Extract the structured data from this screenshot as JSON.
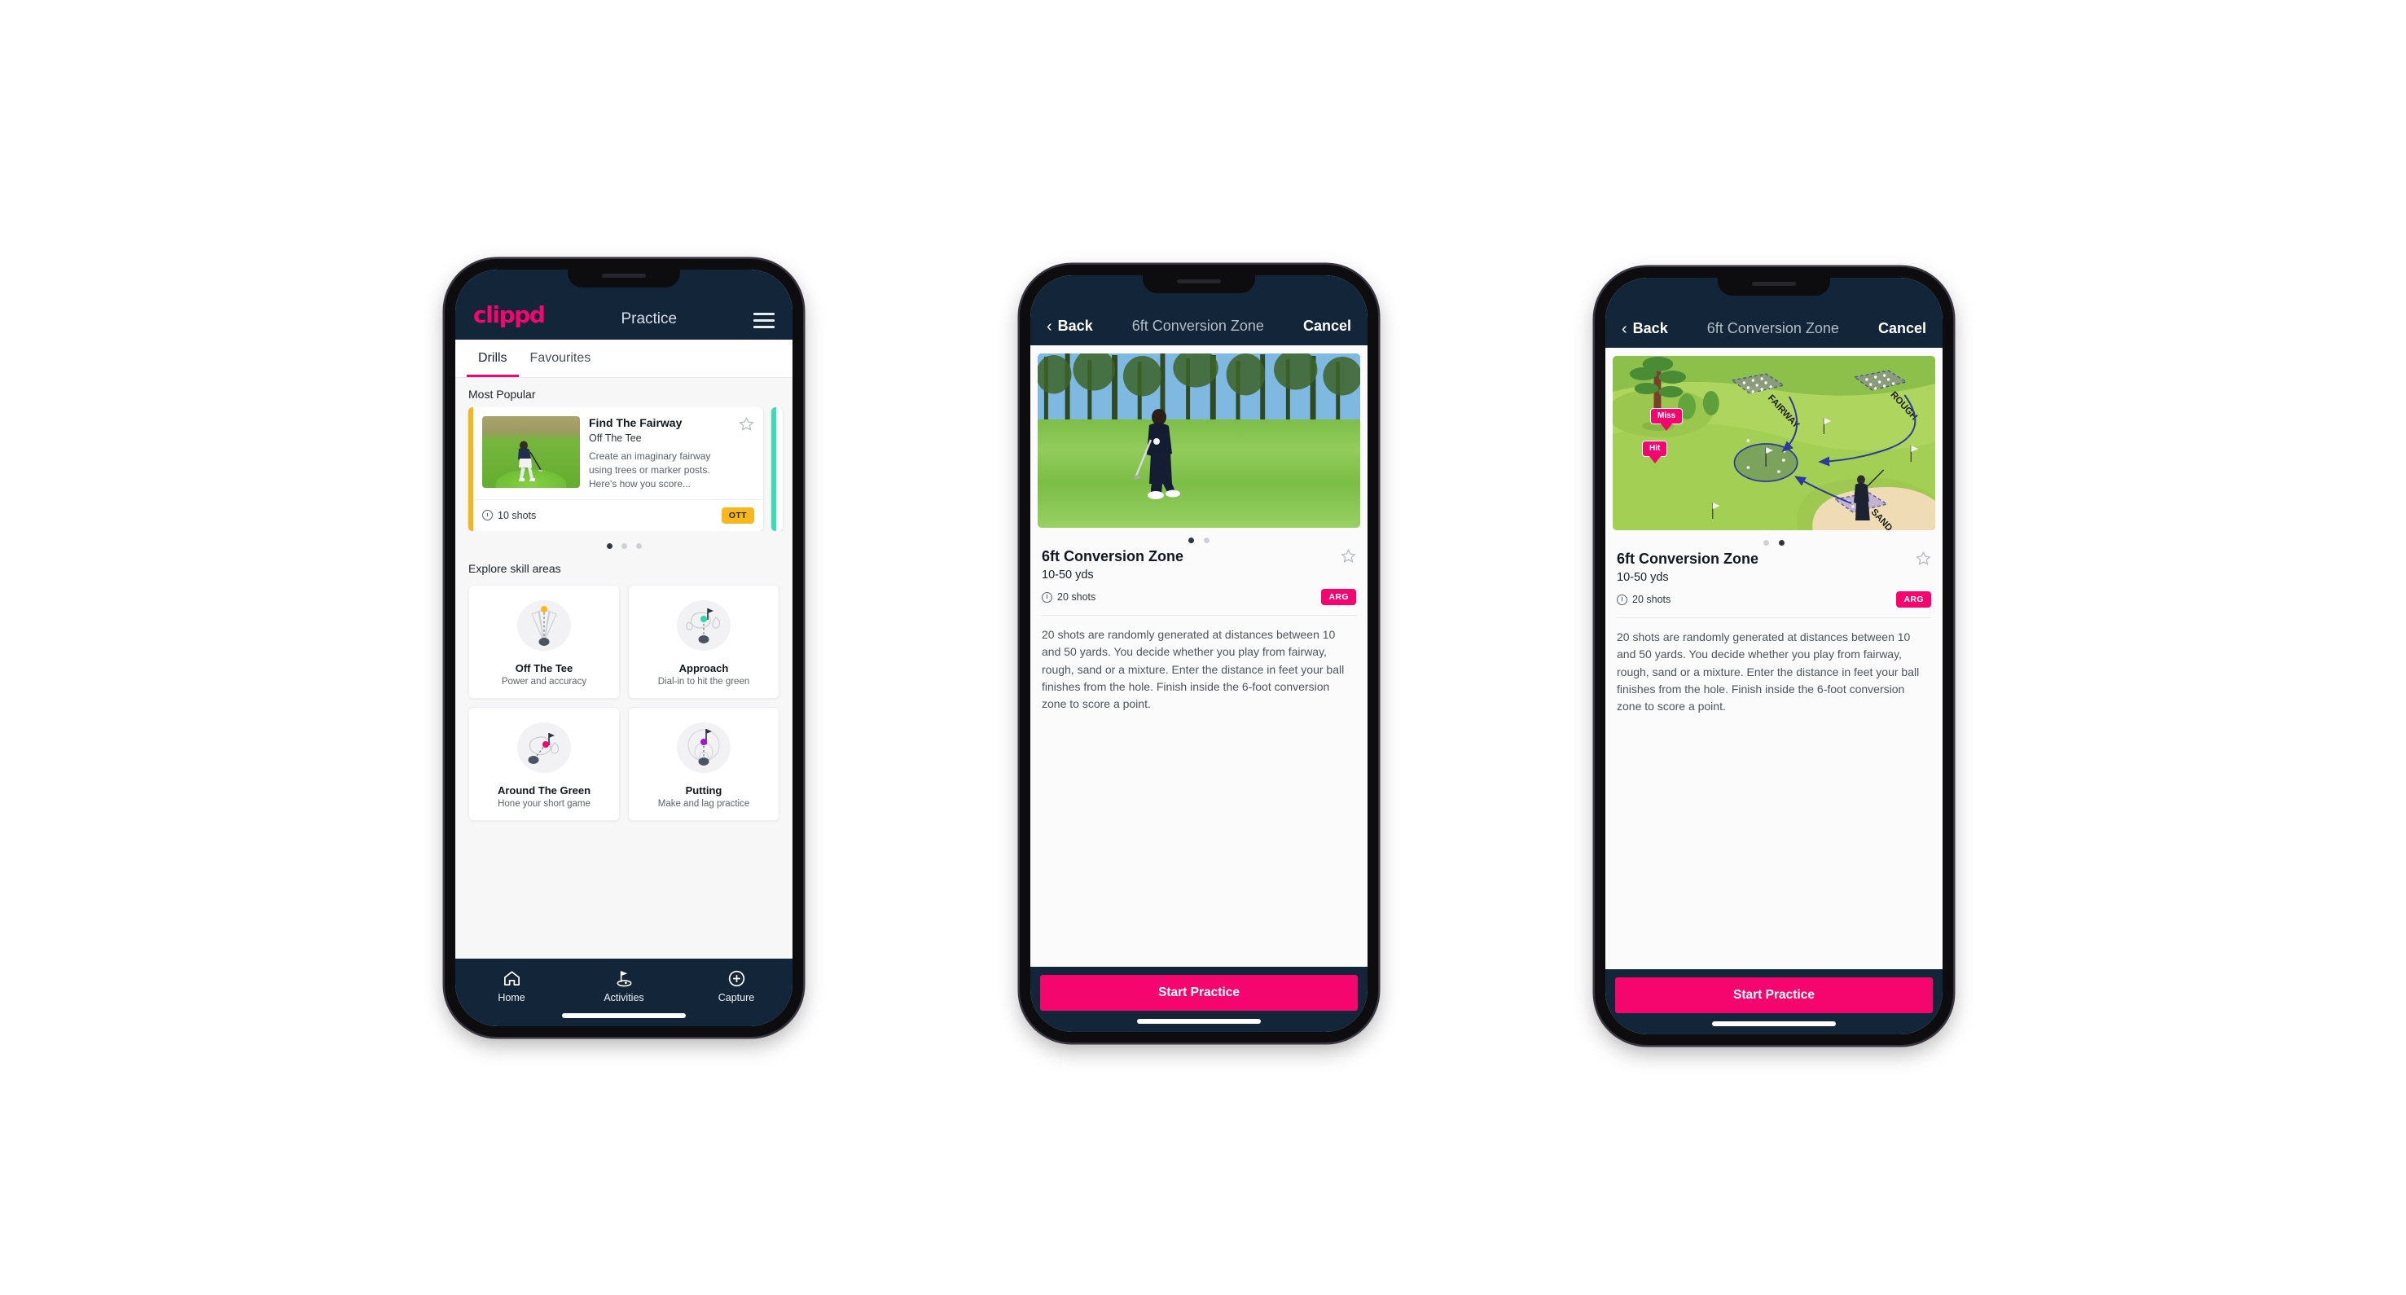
{
  "app": {
    "brand": "clippd",
    "accent_pink": "#f5056e",
    "dark_navy": "#132639",
    "badge_amber": "#f7b81d",
    "accent_teal": "#3ddbb4"
  },
  "phone1": {
    "appbar": {
      "logo": "clippd",
      "title": "Practice",
      "menu_icon": "hamburger-menu-icon"
    },
    "tabs": [
      {
        "label": "Drills",
        "active": true
      },
      {
        "label": "Favourites",
        "active": false
      }
    ],
    "sections": {
      "most_popular_label": "Most Popular",
      "explore_label": "Explore skill areas"
    },
    "drill_card": {
      "title": "Find The Fairway",
      "subtitle": "Off The Tee",
      "description": "Create an imaginary fairway using trees or marker posts. Here's how you score...",
      "shots": "10 shots",
      "badge": "OTT",
      "favourite_icon": "star-outline-icon"
    },
    "carousel_dots": 3,
    "carousel_active": 1,
    "skill_areas": [
      {
        "name": "Off The Tee",
        "desc": "Power and accuracy",
        "icon": "tee-fan-icon",
        "dot_color": "#f7b81d"
      },
      {
        "name": "Approach",
        "desc": "Dial-in to hit the green",
        "icon": "approach-green-icon",
        "dot_color": "#2fd6ac"
      },
      {
        "name": "Around The Green",
        "desc": "Hone your short game",
        "icon": "chip-green-icon",
        "dot_color": "#f5056e"
      },
      {
        "name": "Putting",
        "desc": "Make and lag practice",
        "icon": "putting-rings-icon",
        "dot_color": "#a017d8"
      }
    ],
    "bottom_nav": [
      {
        "label": "Home",
        "icon": "home-icon",
        "active": false
      },
      {
        "label": "Activities",
        "icon": "golf-flag-icon",
        "active": true
      },
      {
        "label": "Capture",
        "icon": "plus-circle-icon",
        "active": false
      }
    ]
  },
  "phone2": {
    "navbar": {
      "back": "Back",
      "title": "6ft Conversion Zone",
      "cancel": "Cancel",
      "back_icon": "chevron-left-icon"
    },
    "hero": "golfer-chipping-photo",
    "carousel_dots": 2,
    "carousel_active": 1,
    "detail": {
      "title": "6ft Conversion Zone",
      "yards": "10-50 yds",
      "shots": "20 shots",
      "badge": "ARG",
      "favourite_icon": "star-outline-icon",
      "description": "20 shots are randomly generated at distances between 10 and 50 yards. You decide whether you play from fairway, rough, sand or a mixture. Enter the distance in feet your ball finishes from the hole. Finish inside the 6-foot conversion zone to score a point."
    },
    "cta": "Start Practice"
  },
  "phone3": {
    "navbar": {
      "back": "Back",
      "title": "6ft Conversion Zone",
      "cancel": "Cancel",
      "back_icon": "chevron-left-icon"
    },
    "hero": "golf-course-diagram",
    "diagram": {
      "zones": [
        "FAIRWAY",
        "ROUGH",
        "SAND"
      ],
      "markers": [
        "Miss",
        "Hit"
      ]
    },
    "carousel_dots": 2,
    "carousel_active": 2,
    "detail": {
      "title": "6ft Conversion Zone",
      "yards": "10-50 yds",
      "shots": "20 shots",
      "badge": "ARG",
      "favourite_icon": "star-outline-icon",
      "description": "20 shots are randomly generated at distances between 10 and 50 yards. You decide whether you play from fairway, rough, sand or a mixture. Enter the distance in feet your ball finishes from the hole. Finish inside the 6-foot conversion zone to score a point."
    },
    "cta": "Start Practice"
  }
}
